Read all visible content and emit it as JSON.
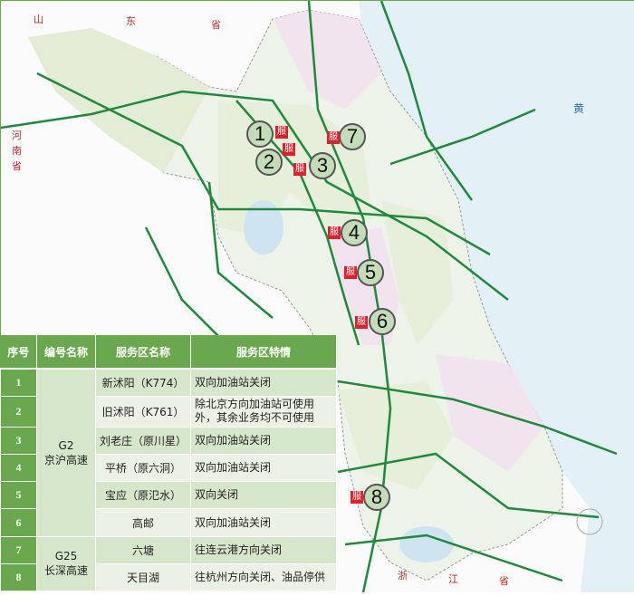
{
  "map_labels": {
    "shandong": [
      "山",
      "东",
      "省"
    ],
    "henan": [
      "河",
      "南",
      "省"
    ],
    "sea": "黄",
    "zhejiang": [
      "浙",
      "江",
      "省"
    ]
  },
  "service_icon": "服",
  "markers": [
    "1",
    "2",
    "3",
    "4",
    "5",
    "6",
    "7",
    "8"
  ],
  "table": {
    "headers": [
      "序号",
      "编号名称",
      "服务区名称",
      "服务区特情"
    ],
    "groups": [
      {
        "code": "G2",
        "name": "京沪高速"
      },
      {
        "code": "G25",
        "name": "长深高速"
      }
    ],
    "rows": [
      {
        "no": "1",
        "name": "新沭阳（K774）",
        "status": "双向加油站关闭"
      },
      {
        "no": "2",
        "name": "旧沭阳（K761）",
        "status": "除北京方向加油站可使用外，其余业务均不可使用"
      },
      {
        "no": "3",
        "name": "刘老庄（原川星）",
        "status": "双向加油站关闭"
      },
      {
        "no": "4",
        "name": "平桥（原六洞）",
        "status": "双向加油站关闭"
      },
      {
        "no": "5",
        "name": "宝应（原氾水）",
        "status": "双向关闭"
      },
      {
        "no": "6",
        "name": "高邮",
        "status": "双向加油站关闭"
      },
      {
        "no": "7",
        "name": "六塘",
        "status": "往连云港方向关闭"
      },
      {
        "no": "8",
        "name": "天目湖",
        "status": "往杭州方向关闭、油品停供"
      }
    ]
  },
  "colors": {
    "header": "#6aa84f",
    "road": "#1e8a3c",
    "service": "#e0202a",
    "province": "#e6efd9",
    "pink": "#f1e4ef",
    "sea": "#e3f1f7"
  }
}
